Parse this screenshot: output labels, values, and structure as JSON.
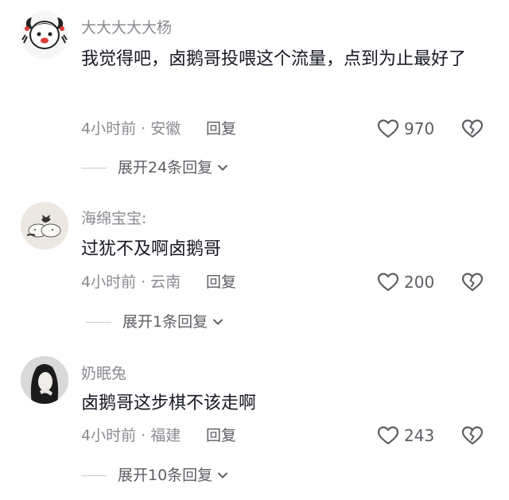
{
  "comments": [
    {
      "username": "大大大大大杨",
      "text": "我觉得吧，卤鹅哥投喂这个流量，点到为止最好了",
      "meta": "4小时前 · 安徽",
      "reply_label": "回复",
      "likes": "970",
      "expand_label": "展开24条回复",
      "avatar_icon": "cartoon-girl-avatar"
    },
    {
      "username": "海绵宝宝:",
      "text": "过犹不及啊卤鹅哥",
      "meta": "4小时前 · 云南",
      "reply_label": "回复",
      "likes": "200",
      "expand_label": "展开1条回复",
      "avatar_icon": "cats-avatar"
    },
    {
      "username": "奶眠兔",
      "text": "卤鹅哥这步棋不该走啊",
      "meta": "4小时前 · 福建",
      "reply_label": "回复",
      "likes": "243",
      "expand_label": "展开10条回复",
      "avatar_icon": "photo-girl-avatar"
    }
  ],
  "colors": {
    "text_primary": "#161823",
    "text_secondary": "#8a8b91",
    "action_text": "#5d5e64",
    "icon_stroke": "#5d5e64"
  }
}
